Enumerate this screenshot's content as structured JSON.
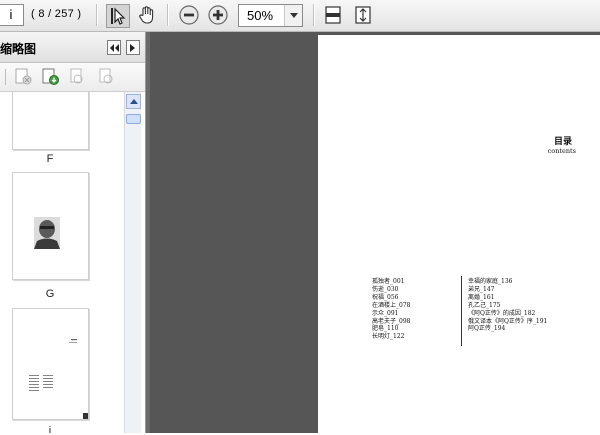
{
  "toolbar": {
    "page_input": "i",
    "page_count": "( 8 / 257 )",
    "zoom_value": "50%"
  },
  "panel": {
    "title": "缩略图",
    "thumbnails": [
      {
        "label": "F"
      },
      {
        "label": "G"
      },
      {
        "label": "i"
      }
    ]
  },
  "document": {
    "heading": "目录",
    "subheading": "contents",
    "toc_left": [
      "孤独者_001",
      "伤逝_030",
      "祝福_056",
      "在酒楼上_078",
      "示众_091",
      "高老夫子_098",
      "肥皂_110",
      "长明灯_122"
    ],
    "toc_right": [
      "幸福的家庭_136",
      "弟兄_147",
      "离婚_161",
      "孔乙己_175",
      "《阿Q正传》的成因_182",
      "俄文译本《阿Q正传》序_191",
      "阿Q正传_194"
    ]
  }
}
